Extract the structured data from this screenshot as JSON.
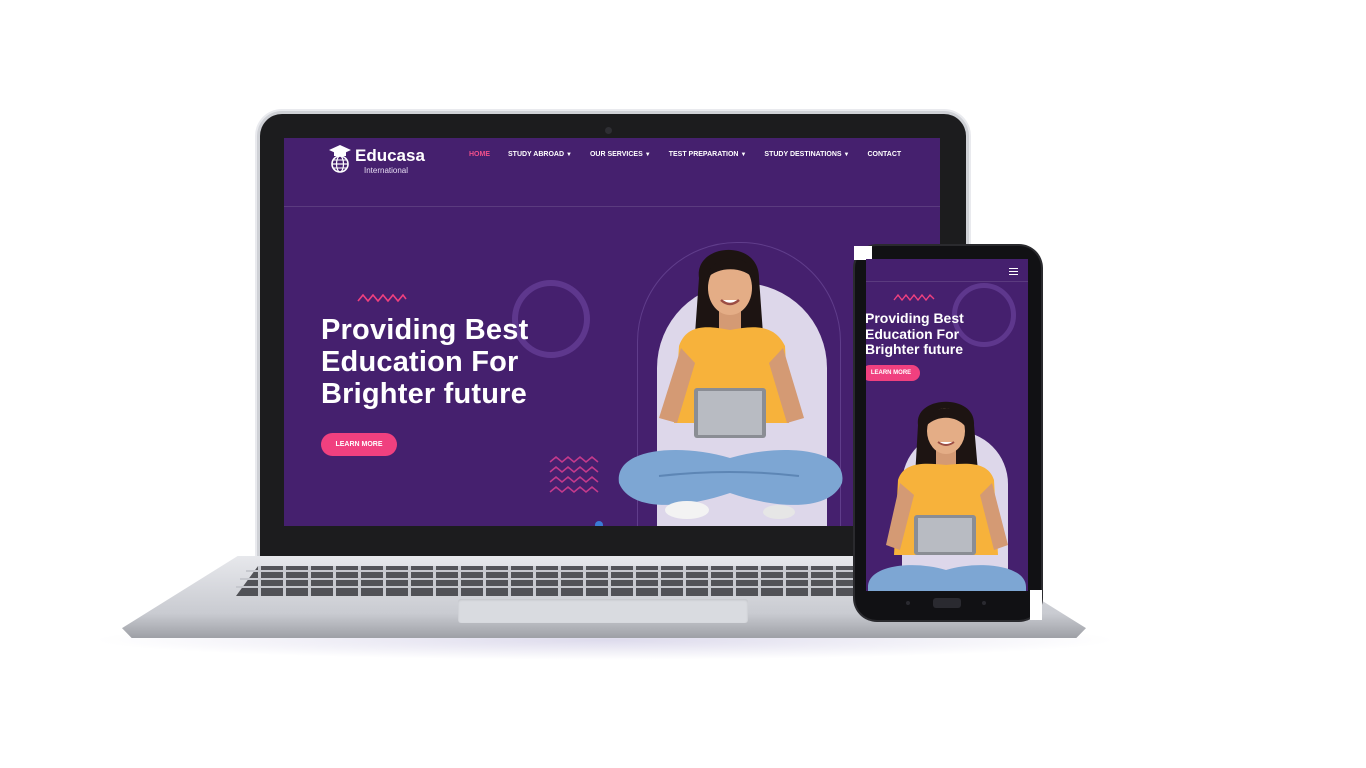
{
  "desktop": {
    "logo": {
      "name": "Educasa",
      "sub": "International"
    },
    "nav": [
      {
        "label": "HOME",
        "active": true,
        "dropdown": false
      },
      {
        "label": "STUDY ABROAD",
        "active": false,
        "dropdown": true
      },
      {
        "label": "OUR SERVICES",
        "active": false,
        "dropdown": true
      },
      {
        "label": "TEST PREPARATION",
        "active": false,
        "dropdown": true
      },
      {
        "label": "STUDY DESTINATIONS",
        "active": false,
        "dropdown": true
      },
      {
        "label": "CONTACT",
        "active": false,
        "dropdown": false
      }
    ],
    "hero": {
      "line1": "Providing Best",
      "line2": "Education For",
      "line3": "Brighter future",
      "cta": "LEARN MORE"
    }
  },
  "mobile": {
    "hero": {
      "line1": "Providing Best",
      "line2": "Education For",
      "line3": "Brighter future",
      "cta": "LEARN MORE"
    }
  },
  "colors": {
    "background_purple": "#45206e",
    "accent_pink": "#f0407f",
    "arch_lavender": "#ddd7ea",
    "shirt_yellow": "#f7b23b",
    "jeans_blue": "#7da6d3"
  },
  "icons": {
    "caret": "chevron-down-icon",
    "menu": "hamburger-icon",
    "logo": "graduation-globe-icon"
  }
}
